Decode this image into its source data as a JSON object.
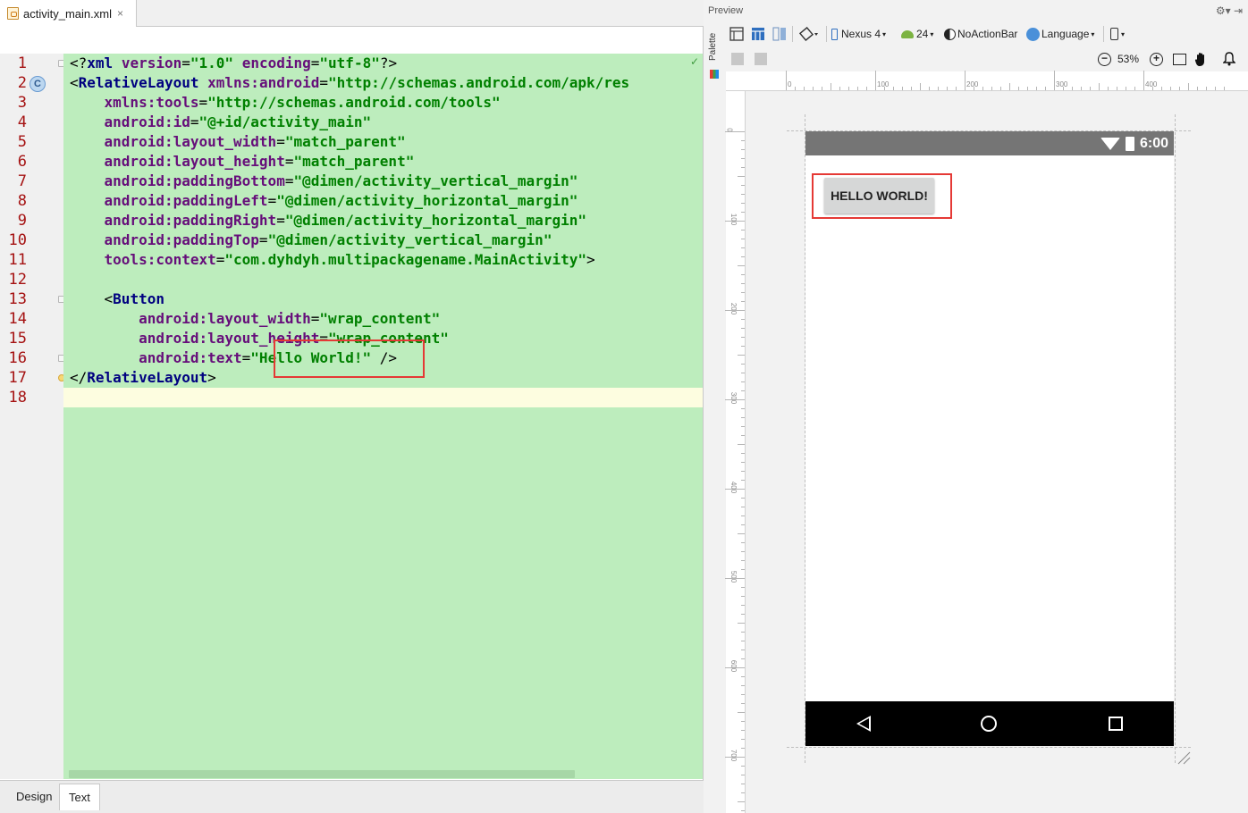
{
  "editor": {
    "tab": {
      "filename": "activity_main.xml",
      "close": "×"
    },
    "line_numbers": [
      "1",
      "2",
      "3",
      "4",
      "5",
      "6",
      "7",
      "8",
      "9",
      "10",
      "11",
      "12",
      "13",
      "14",
      "15",
      "16",
      "17",
      "18"
    ],
    "gutter_badge": "C",
    "check": "✓",
    "code": [
      [
        "<?",
        "xml",
        " ",
        "version",
        "=",
        "\"1.0\"",
        " ",
        "encoding",
        "=",
        "\"utf-8\"",
        "?>"
      ],
      [
        "<",
        "RelativeLayout",
        " ",
        "xmlns:android",
        "=",
        "\"http://schemas.android.com/apk/res"
      ],
      [
        "    ",
        "xmlns:tools",
        "=",
        "\"http://schemas.android.com/tools\""
      ],
      [
        "    ",
        "android:id",
        "=",
        "\"@+id/activity_main\""
      ],
      [
        "    ",
        "android:layout_width",
        "=",
        "\"match_parent\""
      ],
      [
        "    ",
        "android:layout_height",
        "=",
        "\"match_parent\""
      ],
      [
        "    ",
        "android:paddingBottom",
        "=",
        "\"@dimen/activity_vertical_margin\""
      ],
      [
        "    ",
        "android:paddingLeft",
        "=",
        "\"@dimen/activity_horizontal_margin\""
      ],
      [
        "    ",
        "android:paddingRight",
        "=",
        "\"@dimen/activity_horizontal_margin\""
      ],
      [
        "    ",
        "android:paddingTop",
        "=",
        "\"@dimen/activity_vertical_margin\""
      ],
      [
        "    ",
        "tools:context",
        "=",
        "\"com.dyhdyh.multipackagename.MainActivity\"",
        ">"
      ],
      [
        ""
      ],
      [
        "    <",
        "Button"
      ],
      [
        "        ",
        "android:layout_width",
        "=",
        "\"wrap_content\""
      ],
      [
        "        ",
        "android:layout_height",
        "=",
        "\"wrap_content\""
      ],
      [
        "        ",
        "android:text",
        "=",
        "\"Hello World!\"",
        " />"
      ],
      [
        "</",
        "RelativeLayout",
        ">"
      ],
      [
        ""
      ]
    ],
    "code_classes": [
      [
        "p",
        "n",
        "p",
        "a",
        "p",
        "v",
        "p",
        "a",
        "p",
        "v",
        "p"
      ],
      [
        "p",
        "n",
        "p",
        "a",
        "p",
        "v"
      ],
      [
        "p",
        "a",
        "p",
        "v"
      ],
      [
        "p",
        "a",
        "p",
        "v"
      ],
      [
        "p",
        "a",
        "p",
        "v"
      ],
      [
        "p",
        "a",
        "p",
        "v"
      ],
      [
        "p",
        "a",
        "p",
        "v"
      ],
      [
        "p",
        "a",
        "p",
        "v"
      ],
      [
        "p",
        "a",
        "p",
        "v"
      ],
      [
        "p",
        "a",
        "p",
        "v"
      ],
      [
        "p",
        "a",
        "p",
        "v",
        "p"
      ],
      [
        "p"
      ],
      [
        "p",
        "n"
      ],
      [
        "p",
        "a",
        "p",
        "v"
      ],
      [
        "p",
        "a",
        "p",
        "v"
      ],
      [
        "p",
        "a",
        "p",
        "v",
        "p"
      ],
      [
        "p",
        "n",
        "p"
      ],
      [
        "p"
      ]
    ],
    "bottom_tabs": [
      "Design",
      "Text"
    ],
    "active_bottom_tab": "Text"
  },
  "preview": {
    "title": "Preview",
    "toolbar": {
      "device": "Nexus 4",
      "api": "24",
      "theme": "NoActionBar",
      "language": "Language",
      "zoom": "53%"
    },
    "palette_label": "Palette",
    "ruler_h": [
      "0",
      "100",
      "200",
      "300",
      "400"
    ],
    "ruler_v": [
      "0",
      "100",
      "200",
      "300",
      "400",
      "500",
      "600",
      "700"
    ],
    "status_time": "6:00",
    "button_label": "HELLO WORLD!"
  },
  "colors": {
    "code_bg": "#bdedbd",
    "highlight_box": "#e53935",
    "status_bar": "#757575",
    "nav_bar": "#000000"
  }
}
